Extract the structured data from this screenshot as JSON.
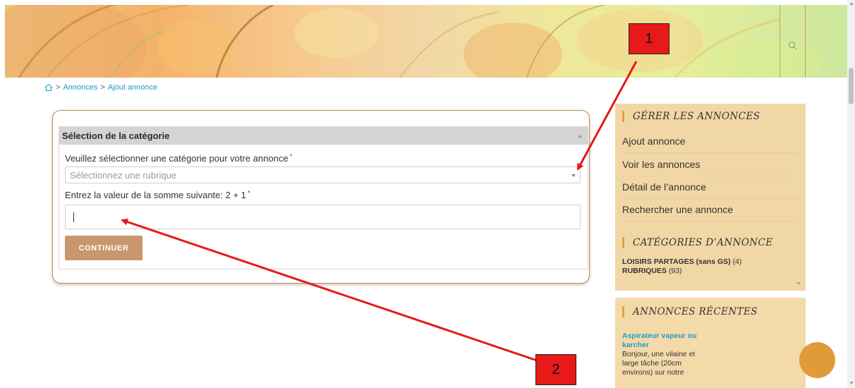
{
  "header": {
    "search_icon": "search-icon"
  },
  "breadcrumb": {
    "home_icon": "home-icon",
    "separator1": ">",
    "item1": "Annonces",
    "separator2": ">",
    "item2": "Ajout annonce"
  },
  "form": {
    "section_title": "Sélection de la catégorie",
    "category_label": "Veuillez sélectionner une catégorie pour votre annonce",
    "category_required": "*",
    "category_placeholder": "Sélectionnez une rubrique",
    "sum_label": "Entrez la valeur de la somme suivante: 2 + 1",
    "sum_required": "*",
    "sum_value": "",
    "continue_label": "CONTINUER"
  },
  "sidebar": {
    "manage_title": "Gérer les annonces",
    "manage_links": [
      "Ajout annonce",
      "Voir les annonces",
      "Détail de l’annonce",
      "Rechercher une annonce"
    ],
    "categories_title": "Catégories d’annonce",
    "categories": [
      {
        "name": "LOISIRS PARTAGES (sans GS)",
        "count": "(4)"
      },
      {
        "name": "RUBRIQUES",
        "count": "(93)"
      }
    ],
    "recent_title": "Annonces récentes",
    "recent_item_title": [
      "Aspirateur vapeur ou",
      "karcher"
    ],
    "recent_item_text": [
      "Bonjour, une vilaine et",
      "large tâche (20cm",
      "environs) sur notre"
    ]
  },
  "annotations": {
    "label1": "1",
    "label2": "2"
  },
  "colors": {
    "accent": "#1e9bc8",
    "button": "#c9976d",
    "sidebar_bg": "#f2d7a6",
    "annotation": "#e81919",
    "fab": "#e09a3a"
  }
}
